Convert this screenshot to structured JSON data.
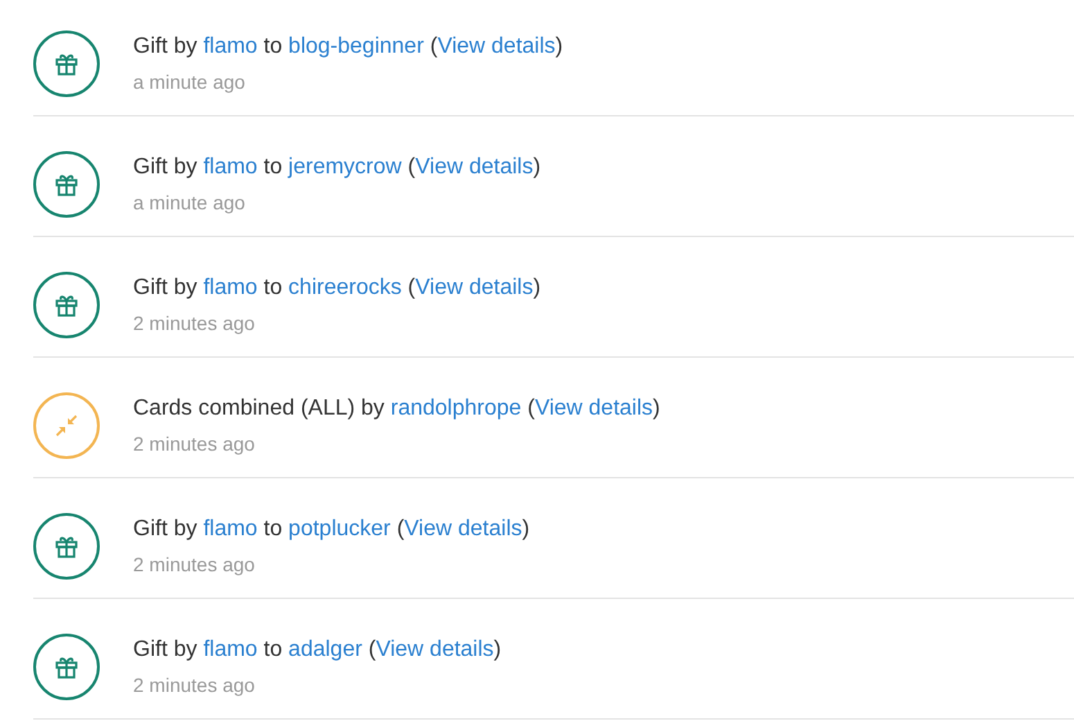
{
  "activity": [
    {
      "kind": "gift",
      "segments": [
        {
          "text": "Gift by ",
          "link": false
        },
        {
          "text": "flamo",
          "link": true
        },
        {
          "text": " to ",
          "link": false
        },
        {
          "text": "blog-beginner",
          "link": true
        },
        {
          "text": " (",
          "link": false
        },
        {
          "text": "View details",
          "link": true
        },
        {
          "text": ")",
          "link": false
        }
      ],
      "time": "a minute ago"
    },
    {
      "kind": "gift",
      "segments": [
        {
          "text": "Gift by ",
          "link": false
        },
        {
          "text": "flamo",
          "link": true
        },
        {
          "text": " to ",
          "link": false
        },
        {
          "text": "jeremycrow",
          "link": true
        },
        {
          "text": " (",
          "link": false
        },
        {
          "text": "View details",
          "link": true
        },
        {
          "text": ")",
          "link": false
        }
      ],
      "time": "a minute ago"
    },
    {
      "kind": "gift",
      "segments": [
        {
          "text": "Gift by ",
          "link": false
        },
        {
          "text": "flamo",
          "link": true
        },
        {
          "text": " to ",
          "link": false
        },
        {
          "text": "chireerocks",
          "link": true
        },
        {
          "text": " (",
          "link": false
        },
        {
          "text": "View details",
          "link": true
        },
        {
          "text": ")",
          "link": false
        }
      ],
      "time": "2 minutes ago"
    },
    {
      "kind": "combine",
      "segments": [
        {
          "text": "Cards combined (ALL) by ",
          "link": false
        },
        {
          "text": "randolphrope",
          "link": true
        },
        {
          "text": " (",
          "link": false
        },
        {
          "text": "View details",
          "link": true
        },
        {
          "text": ")",
          "link": false
        }
      ],
      "time": "2 minutes ago"
    },
    {
      "kind": "gift",
      "segments": [
        {
          "text": "Gift by ",
          "link": false
        },
        {
          "text": "flamo",
          "link": true
        },
        {
          "text": " to ",
          "link": false
        },
        {
          "text": "potplucker",
          "link": true
        },
        {
          "text": " (",
          "link": false
        },
        {
          "text": "View details",
          "link": true
        },
        {
          "text": ")",
          "link": false
        }
      ],
      "time": "2 minutes ago"
    },
    {
      "kind": "gift",
      "segments": [
        {
          "text": "Gift by ",
          "link": false
        },
        {
          "text": "flamo",
          "link": true
        },
        {
          "text": " to ",
          "link": false
        },
        {
          "text": "adalger",
          "link": true
        },
        {
          "text": " (",
          "link": false
        },
        {
          "text": "View details",
          "link": true
        },
        {
          "text": ")",
          "link": false
        }
      ],
      "time": "2 minutes ago"
    }
  ]
}
